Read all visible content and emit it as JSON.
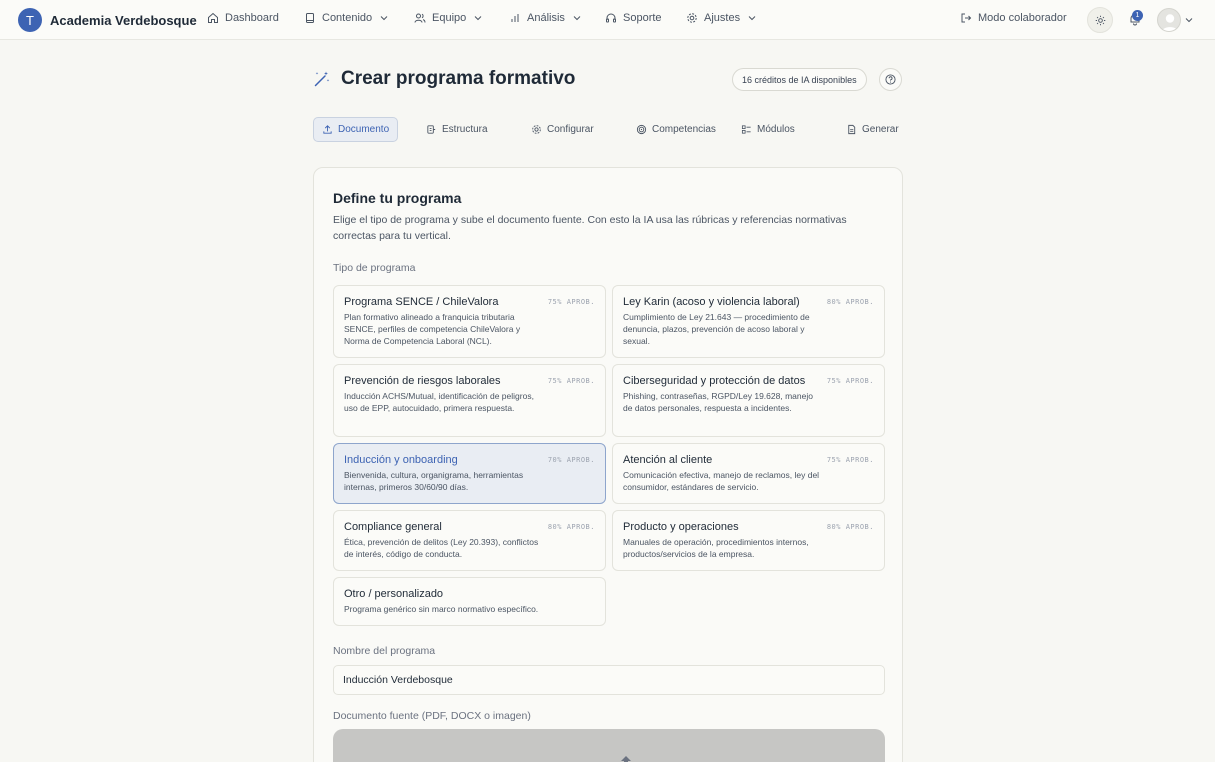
{
  "app": {
    "brand_initial": "T",
    "brand_name": "Academia Verdebosque"
  },
  "nav": {
    "items": [
      {
        "label": "Dashboard",
        "icon": "home-icon",
        "dropdown": false
      },
      {
        "label": "Contenido",
        "icon": "book-icon",
        "dropdown": true
      },
      {
        "label": "Equipo",
        "icon": "users-icon",
        "dropdown": true
      },
      {
        "label": "Análisis",
        "icon": "bar-chart-icon",
        "dropdown": true
      },
      {
        "label": "Soporte",
        "icon": "headset-icon",
        "dropdown": false
      },
      {
        "label": "Ajustes",
        "icon": "gear-icon",
        "dropdown": true
      }
    ],
    "collaborator_mode": "Modo colaborador",
    "notifications_count": "1"
  },
  "page": {
    "title": "Crear programa formativo",
    "credits": "16 créditos de IA disponibles"
  },
  "steps": [
    {
      "label": "Documento",
      "icon": "upload-icon",
      "active": true
    },
    {
      "label": "Estructura",
      "icon": "structure-icon",
      "active": false
    },
    {
      "label": "Configurar",
      "icon": "gear-icon",
      "active": false
    },
    {
      "label": "Competencias",
      "icon": "target-icon",
      "active": false
    },
    {
      "label": "Módulos",
      "icon": "list-icon",
      "active": false
    },
    {
      "label": "Generar",
      "icon": "document-icon",
      "active": false
    }
  ],
  "form": {
    "title": "Define tu programa",
    "description": "Elige el tipo de programa y sube el documento fuente. Con esto la IA usa las rúbricas y referencias normativas correctas para tu vertical.",
    "type_label": "Tipo de programa",
    "options": [
      {
        "title": "Programa SENCE / ChileValora",
        "rate": "75% APROB.",
        "desc": "Plan formativo alineado a franquicia tributaria SENCE, perfiles de competencia ChileValora y Norma de Competencia Laboral (NCL).",
        "selected": false
      },
      {
        "title": "Ley Karin (acoso y violencia laboral)",
        "rate": "80% APROB.",
        "desc": "Cumplimiento de Ley 21.643 — procedimiento de denuncia, plazos, prevención de acoso laboral y sexual.",
        "selected": false
      },
      {
        "title": "Prevención de riesgos laborales",
        "rate": "75% APROB.",
        "desc": "Inducción ACHS/Mutual, identificación de peligros, uso de EPP, autocuidado, primera respuesta.",
        "selected": false
      },
      {
        "title": "Ciberseguridad y protección de datos",
        "rate": "75% APROB.",
        "desc": "Phishing, contraseñas, RGPD/Ley 19.628, manejo de datos personales, respuesta a incidentes.",
        "selected": false
      },
      {
        "title": "Inducción y onboarding",
        "rate": "70% APROB.",
        "desc": "Bienvenida, cultura, organigrama, herramientas internas, primeros 30/60/90 días.",
        "selected": true
      },
      {
        "title": "Atención al cliente",
        "rate": "75% APROB.",
        "desc": "Comunicación efectiva, manejo de reclamos, ley del consumidor, estándares de servicio.",
        "selected": false
      },
      {
        "title": "Compliance general",
        "rate": "80% APROB.",
        "desc": "Ética, prevención de delitos (Ley 20.393), conflictos de interés, código de conducta.",
        "selected": false
      },
      {
        "title": "Producto y operaciones",
        "rate": "80% APROB.",
        "desc": "Manuales de operación, procedimientos internos, productos/servicios de la empresa.",
        "selected": false
      },
      {
        "title": "Otro / personalizado",
        "rate": "",
        "desc": "Programa genérico sin marco normativo específico.",
        "selected": false
      }
    ],
    "name_label": "Nombre del programa",
    "name_value": "Inducción Verdebosque",
    "doc_label": "Documento fuente (PDF, DOCX o imagen)"
  },
  "colors": {
    "accent": "#3d63b3",
    "background": "#f7f7f3",
    "selected_bg": "#e9edf3"
  }
}
